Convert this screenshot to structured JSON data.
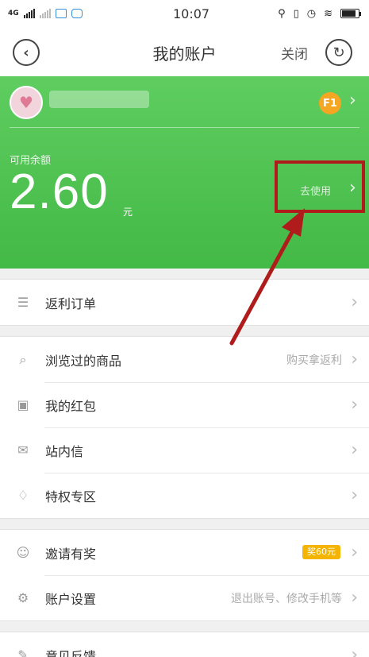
{
  "status_bar": {
    "network": "4G",
    "time": "10:07",
    "icons": [
      "signal-icon",
      "signal-icon",
      "message-icon",
      "app-icon",
      "location-icon",
      "vibrate-icon",
      "alarm-icon",
      "wifi-icon",
      "battery-icon"
    ],
    "battery_level": 0.85
  },
  "nav": {
    "title": "我的账户",
    "close_label": "关闭",
    "back_icon": "back-icon",
    "refresh_icon": "refresh-icon"
  },
  "account": {
    "avatar_icon": "avatar-heart-icon",
    "level_badge": "F1",
    "balance_label": "可用余额",
    "balance_amount": "2.60",
    "balance_unit": "元",
    "use_link": "去使用",
    "colors": {
      "hero_green": "#4cc04e",
      "badge_orange": "#f5a623",
      "highlight_red": "#b01c1c"
    }
  },
  "group1": [
    {
      "label": "返利订单",
      "icon": "order-list-icon",
      "extra": ""
    }
  ],
  "group2": [
    {
      "label": "浏览过的商品",
      "icon": "search-icon",
      "extra": "购买拿返利"
    },
    {
      "label": "我的红包",
      "icon": "red-packet-icon",
      "extra": ""
    },
    {
      "label": "站内信",
      "icon": "mail-icon",
      "extra": ""
    },
    {
      "label": "特权专区",
      "icon": "diamond-icon",
      "extra": ""
    }
  ],
  "group3": [
    {
      "label": "邀请有奖",
      "icon": "invite-icon",
      "badge": "奖60元"
    },
    {
      "label": "账户设置",
      "icon": "settings-icon",
      "extra": "退出账号、修改手机等"
    }
  ],
  "group4": [
    {
      "label": "意见反馈",
      "icon": "feedback-icon",
      "extra": ""
    }
  ]
}
